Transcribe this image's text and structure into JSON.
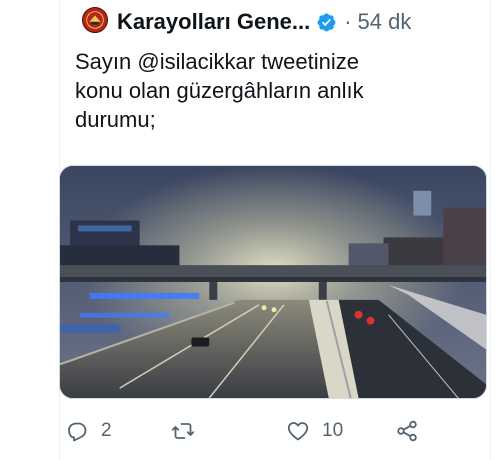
{
  "tweet": {
    "display_name": "Karayolları Gene...",
    "separator": "·",
    "time": "54 dk",
    "text_lines": [
      "Sayın @isilacikkar tweetinize",
      "konu olan güzergâhların anlık",
      "durumu;"
    ],
    "avatar_logo": "KGM",
    "media_icon": "night-highway-snow-photo",
    "verified_icon": "verified-badge-icon"
  },
  "actions": {
    "reply_count": "2",
    "retweet_count": "",
    "like_count": "10"
  },
  "colors": {
    "text_primary": "#0f1419",
    "text_secondary": "#536471",
    "verified_blue": "#1d9bf0",
    "avatar_red": "#b3261e"
  }
}
